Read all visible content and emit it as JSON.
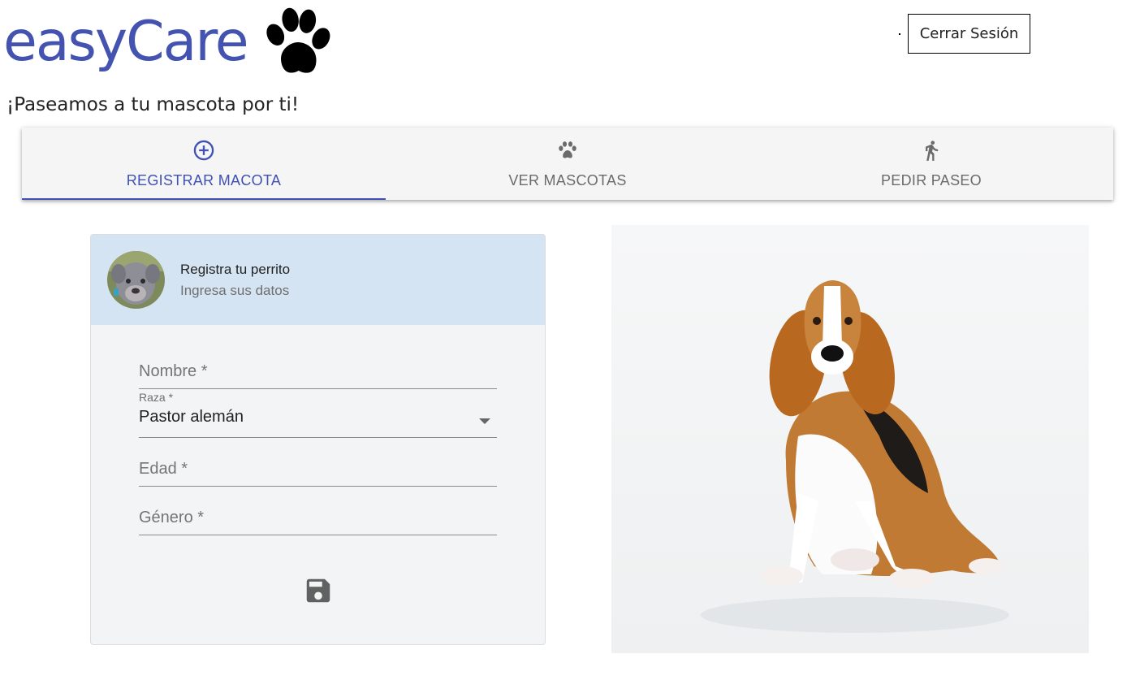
{
  "header": {
    "logo_text": "easyCare",
    "tagline": "¡Paseamos a tu mascota por ti!",
    "logout_label": "Cerrar Sesión"
  },
  "tabs": [
    {
      "label": "REGISTRAR MACOTA",
      "icon": "add-circle-icon",
      "active": true
    },
    {
      "label": "VER MASCOTAS",
      "icon": "paw-icon",
      "active": false
    },
    {
      "label": "PEDIR PASEO",
      "icon": "walk-icon",
      "active": false
    }
  ],
  "form": {
    "title": "Registra tu perrito",
    "subtitle": "Ingresa sus datos",
    "name_placeholder": "Nombre *",
    "breed_label": "Raza *",
    "breed_value": "Pastor alemán",
    "age_placeholder": "Edad *",
    "gender_placeholder": "Género *",
    "save_icon": "save-icon"
  },
  "colors": {
    "brand": "#4453b0",
    "accent": "#3f51b5",
    "card_header": "#d5e4f2"
  }
}
